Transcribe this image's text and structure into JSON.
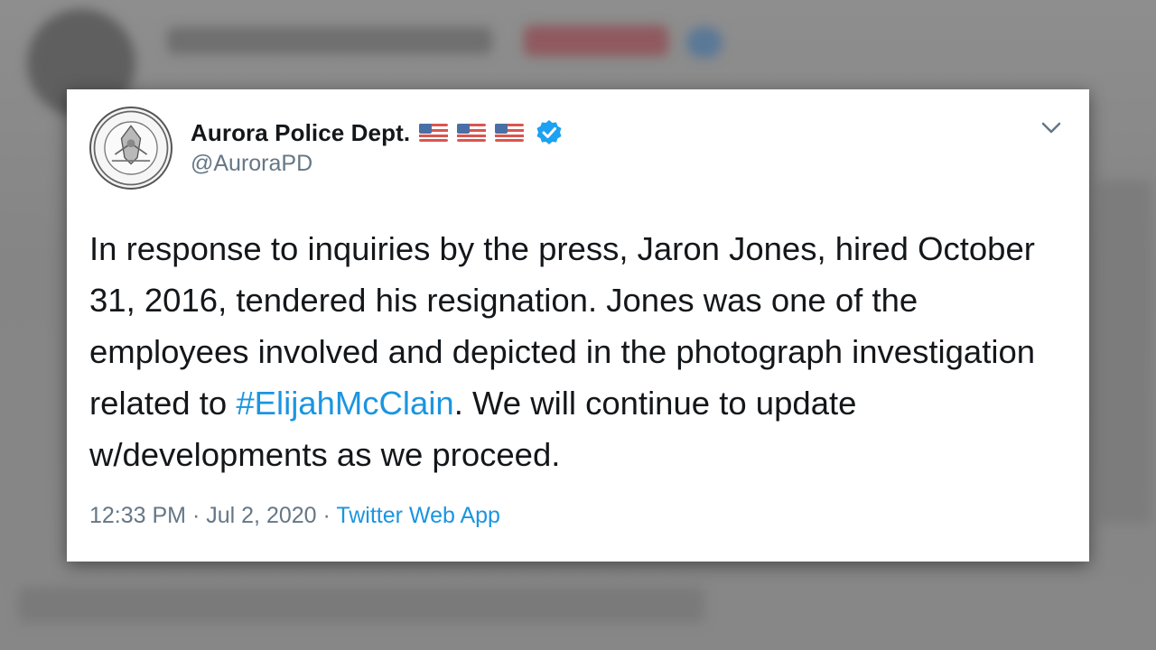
{
  "tweet": {
    "display_name": "Aurora Police Dept.",
    "handle": "@AuroraPD",
    "text_before_hashtag": "In response to inquiries by the press, Jaron Jones, hired October 31, 2016, tendered his resignation.  Jones was one of the employees involved and depicted in the photograph investigation related to ",
    "hashtag": "#ElijahMcClain",
    "text_after_hashtag": ". We will continue to update w/developments as we proceed.",
    "time": "12:33 PM",
    "separator": "·",
    "date": "Jul 2, 2020",
    "source": "Twitter Web App",
    "flags": [
      "us-flag-icon",
      "us-flag-icon",
      "us-flag-icon"
    ],
    "verified_icon": "verified-badge-icon",
    "menu_icon": "chevron-down-icon",
    "avatar_text_top": "AURORA POLICE",
    "avatar_text_bottom": "COMMUNITY COMMITMENT"
  },
  "colors": {
    "link": "#1b95e0",
    "text": "#14171a",
    "secondary": "#657786",
    "verified": "#1da1f2"
  }
}
